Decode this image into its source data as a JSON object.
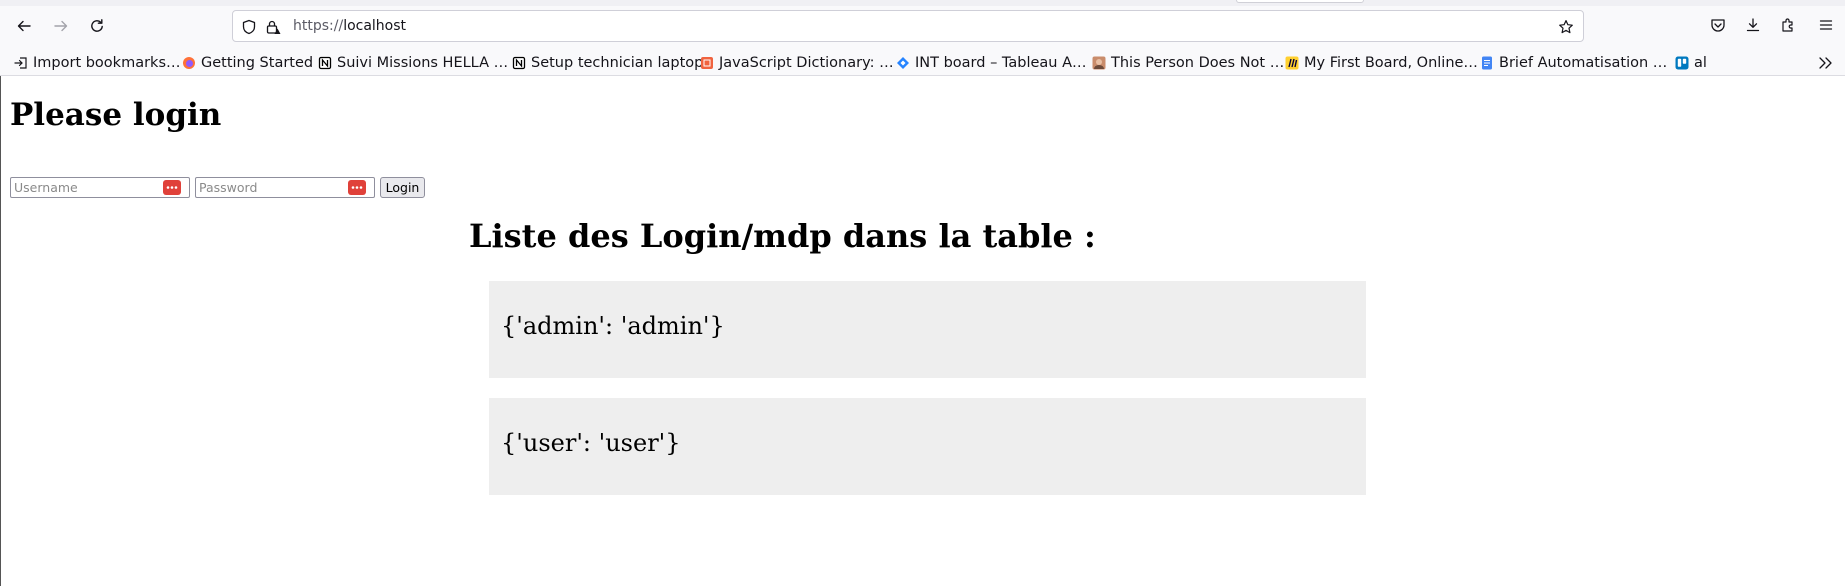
{
  "browser": {
    "url_protocol": "https://",
    "url_host": "localhost",
    "bookmarks": [
      {
        "label": "Import bookmarks…",
        "icon": "import-icon"
      },
      {
        "label": "Getting Started",
        "icon": "firefox-icon"
      },
      {
        "label": "Suivi Missions HELLA …",
        "icon": "notion-icon"
      },
      {
        "label": "Setup technician laptop",
        "icon": "notion-icon"
      },
      {
        "label": "JavaScript Dictionary: …",
        "icon": "js-dictionary-icon"
      },
      {
        "label": "INT board – Tableau A…",
        "icon": "jira-icon"
      },
      {
        "label": "This Person Does Not …",
        "icon": "face-icon"
      },
      {
        "label": "My First Board, Online…",
        "icon": "miro-icon"
      },
      {
        "label": "Brief Automatisation …",
        "icon": "doc-icon"
      },
      {
        "label": "al",
        "icon": "trello-icon"
      }
    ]
  },
  "page": {
    "title": "Please login",
    "username_placeholder": "Username",
    "password_placeholder": "Password",
    "login_label": "Login",
    "list_title": "Liste des Login/mdp dans la table :",
    "credentials": [
      "{'admin': 'admin'}",
      "{'user': 'user'}"
    ]
  },
  "colors": {
    "password_manager_icon": "#e0413a",
    "credential_box_bg": "#eeeeee"
  }
}
